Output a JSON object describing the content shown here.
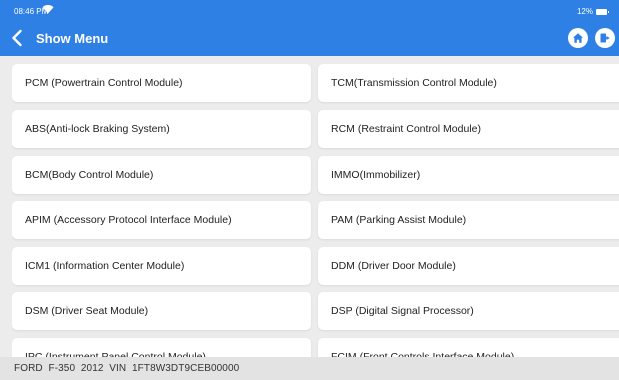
{
  "status_bar": {
    "time": "08:46 PM",
    "battery": "12%"
  },
  "header": {
    "title": "Show Menu"
  },
  "menu": {
    "items": [
      "PCM (Powertrain Control Module)",
      "TCM(Transmission Control Module)",
      "ABS(Anti-lock Braking System)",
      "RCM (Restraint Control Module)",
      "BCM(Body Control Module)",
      "IMMO(Immobilizer)",
      "APIM (Accessory Protocol Interface Module)",
      "PAM (Parking Assist Module)",
      "ICM1 (Information Center Module)",
      "DDM (Driver Door Module)",
      "DSM (Driver Seat Module)",
      "DSP (Digital Signal Processor)",
      "IPC (Instrument Panel Control Module)",
      "FCIM (Front Controls Interface Module)"
    ]
  },
  "footer": {
    "vehicle_info": "FORD  F-350  2012  VIN  1FT8W3DT9CEB00000"
  },
  "colors": {
    "header_bg": "#2f80e4",
    "page_bg": "#ececec",
    "card_bg": "#ffffff",
    "footer_bg": "#e3e3e3"
  },
  "icons": {
    "back": "chevron-left-icon",
    "home": "home-icon",
    "exit": "exit-icon",
    "wifi": "wifi-icon",
    "battery": "battery-icon"
  }
}
